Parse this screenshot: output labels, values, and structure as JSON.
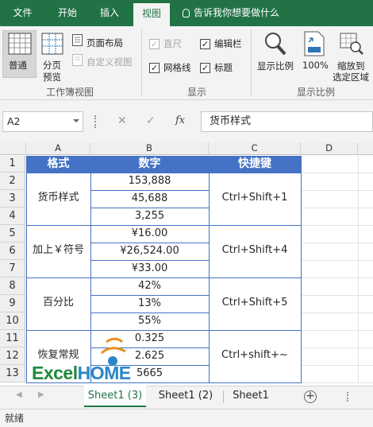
{
  "tabs": [
    {
      "label": "文件"
    },
    {
      "label": "开始"
    },
    {
      "label": "插入"
    },
    {
      "label": "视图"
    }
  ],
  "tell_me": "告诉我你想要做什么",
  "ribbon": {
    "normal": "普通",
    "page_break_1": "分页",
    "page_break_2": "预览",
    "page_layout": "页面布局",
    "custom_view": "自定义视图",
    "ruler": "直尺",
    "formula_bar": "编辑栏",
    "gridlines": "网格线",
    "headings": "标题",
    "zoom": "显示比例",
    "zoom100": "100%",
    "zoom_sel_1": "缩放到",
    "zoom_sel_2": "选定区域",
    "group_views": "工作簿视图",
    "group_show": "显示",
    "group_zoom": "显示比例",
    "ruler_checked": true,
    "formula_bar_checked": true,
    "gridlines_checked": true,
    "headings_checked": true
  },
  "name_box": "A2",
  "fx": "fx",
  "formula": "货币样式",
  "columns": [
    "A",
    "B",
    "C",
    "D"
  ],
  "rows": [
    "1",
    "2",
    "3",
    "4",
    "5",
    "6",
    "7",
    "8",
    "9",
    "10",
    "11",
    "12",
    "13"
  ],
  "table": {
    "headers": [
      "格式",
      "数字",
      "快捷键"
    ],
    "groups": [
      {
        "format": "货币样式",
        "values": [
          "153,888",
          "45,688",
          "3,255"
        ],
        "shortcut": "Ctrl+Shift+1"
      },
      {
        "format": "加上￥符号",
        "values": [
          "¥16.00",
          "¥26,524.00",
          "¥33.00"
        ],
        "shortcut": "Ctrl+Shift+4"
      },
      {
        "format": "百分比",
        "values": [
          "42%",
          "13%",
          "55%"
        ],
        "shortcut": "Ctrl+Shift+5"
      },
      {
        "format": "恢复常规",
        "values": [
          "0.325",
          "2.625",
          "5665"
        ],
        "shortcut": "Ctrl+shift+~"
      }
    ]
  },
  "watermark": "ExcelHOME",
  "sheets": [
    "Sheet1 (3)",
    "Sheet1 (2)",
    "Sheet1"
  ],
  "status": "就绪",
  "colors": {
    "accent": "#217346",
    "table_header": "#4472c4"
  }
}
